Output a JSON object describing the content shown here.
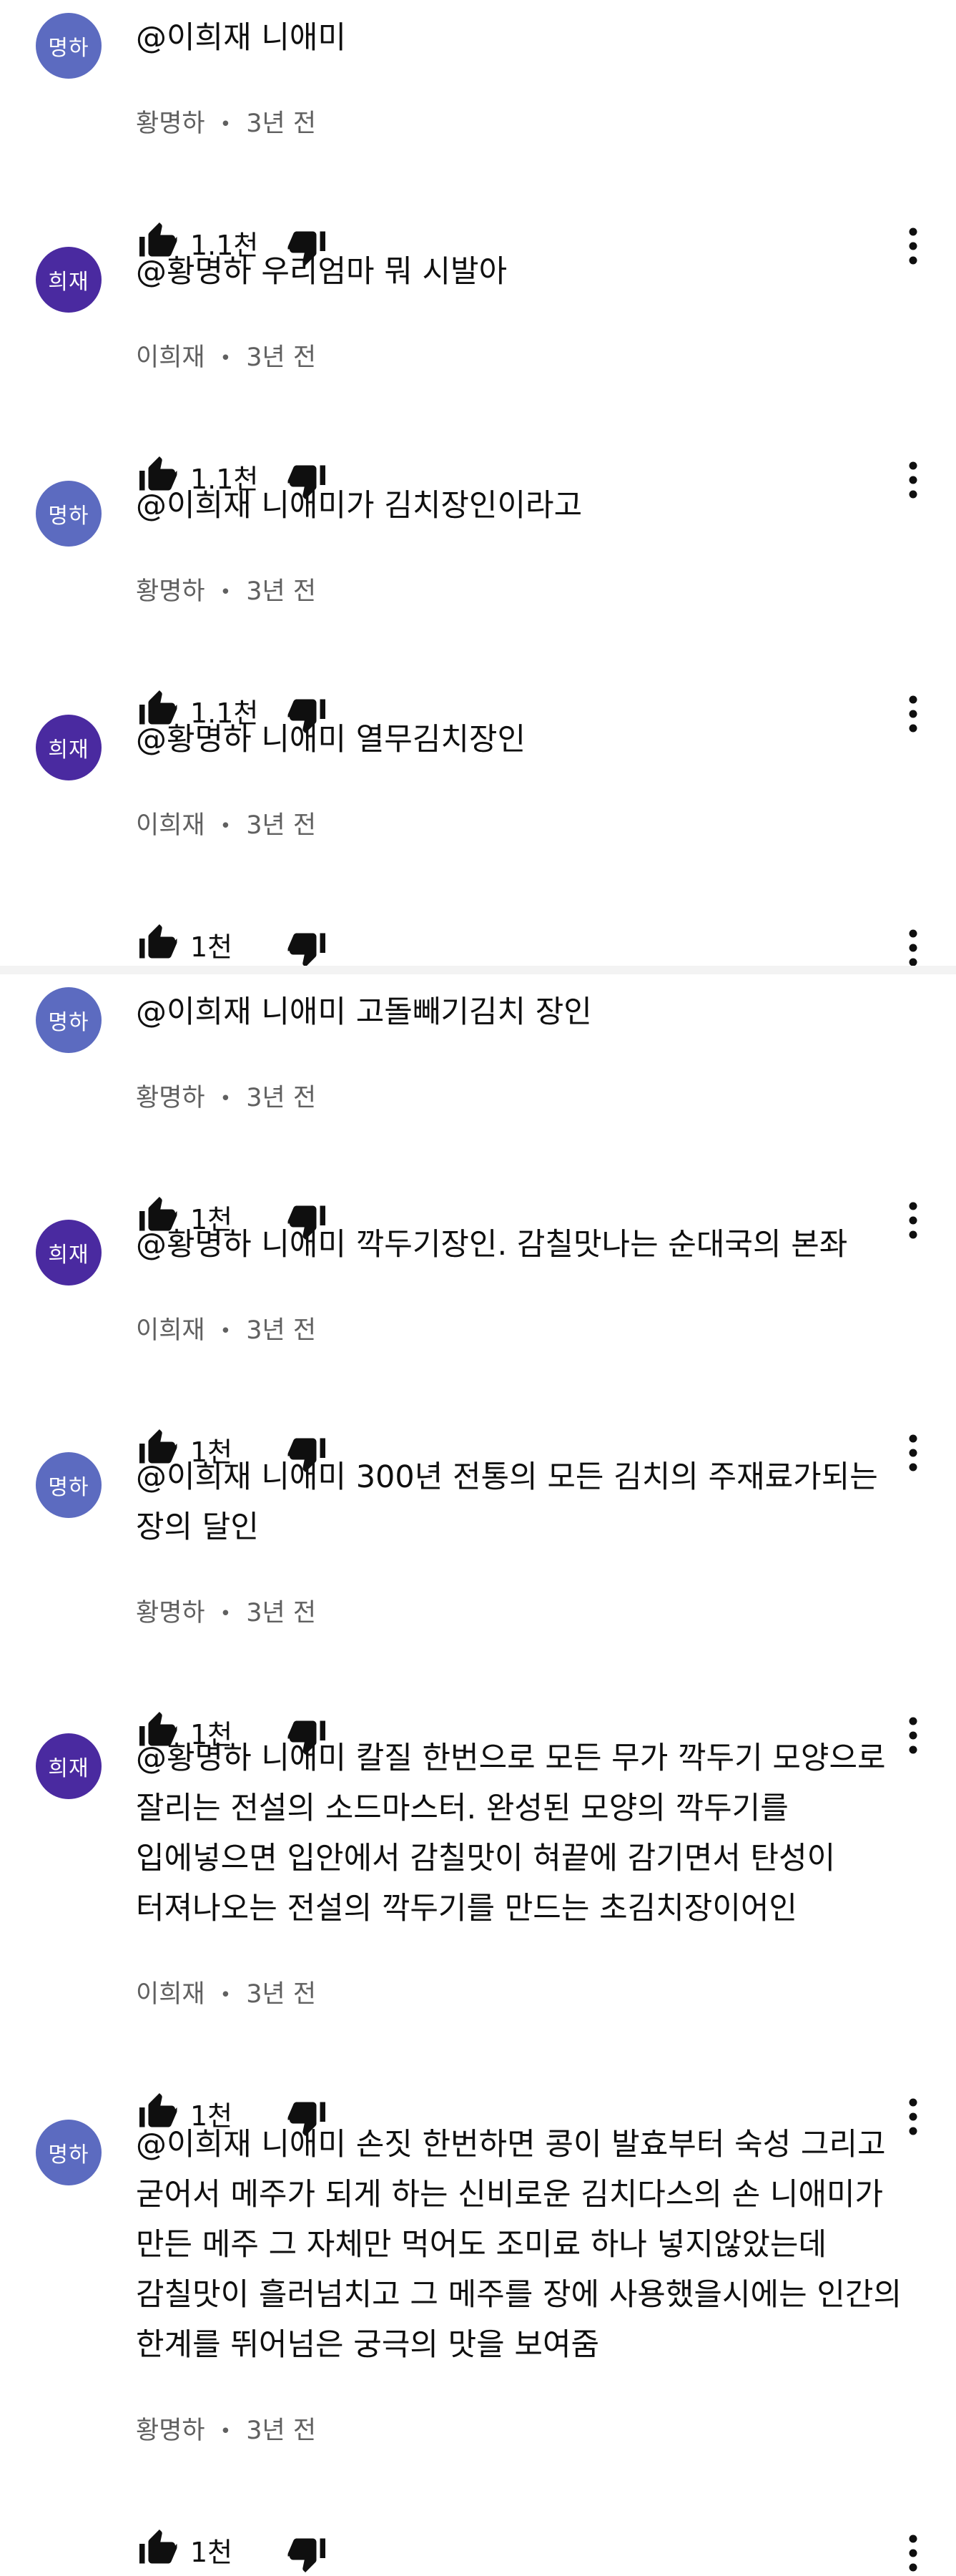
{
  "comments": [
    {
      "initials": "명하",
      "color": "#5c6bc0",
      "text": "@이희재 니애미",
      "author": "황명하",
      "time": "3년 전",
      "likes": "1.1천"
    },
    {
      "initials": "희재",
      "color": "#4a2aa0",
      "text": "@황명하 우리엄마 뭐 시발아",
      "author": "이희재",
      "time": "3년 전",
      "likes": "1.1천"
    },
    {
      "initials": "명하",
      "color": "#5c6bc0",
      "text": "@이희재 니애미가 김치장인이라고",
      "author": "황명하",
      "time": "3년 전",
      "likes": "1.1천"
    },
    {
      "initials": "희재",
      "color": "#4a2aa0",
      "text": "@황명하 니애미 열무김치장인",
      "author": "이희재",
      "time": "3년 전",
      "likes": "1천"
    },
    {
      "initials": "명하",
      "color": "#5c6bc0",
      "text": "@이희재 니애미 고돌빼기김치 장인",
      "author": "황명하",
      "time": "3년 전",
      "likes": "1천"
    },
    {
      "initials": "희재",
      "color": "#4a2aa0",
      "text": "@황명하 니애미 깍두기장인. 감칠맛나는 순대국의 본좌",
      "author": "이희재",
      "time": "3년 전",
      "likes": "1천"
    },
    {
      "initials": "명하",
      "color": "#5c6bc0",
      "text": "@이희재 니애미 300년 전통의 모든 김치의 주재료가되는 장의 달인",
      "author": "황명하",
      "time": "3년 전",
      "likes": "1천"
    },
    {
      "initials": "희재",
      "color": "#4a2aa0",
      "text": "@황명하 니애미 칼질 한번으로 모든 무가 깍두기 모양으로 잘리는 전설의 소드마스터. 완성된 모양의 깍두기를 입에넣으면 입안에서 감칠맛이 혀끝에 감기면서 탄성이 터져나오는 전설의 깍두기를 만드는  초김치장이어인",
      "author": "이희재",
      "time": "3년 전",
      "likes": "1천"
    },
    {
      "initials": "명하",
      "color": "#5c6bc0",
      "text": "@이희재 니애미 손짓 한번하면 콩이 발효부터 숙성 그리고 굳어서 메주가 되게 하는 신비로운 김치다스의 손 니애미가 만든 메주 그 자체만 먹어도 조미료 하나 넣지않았는데 감칠맛이 흘러넘치고 그 메주를 장에 사용했을시에는 인간의 한계를 뛰어넘은 궁극의 맛을 보여줌",
      "author": "황명하",
      "time": "3년 전",
      "likes": "1천"
    }
  ],
  "meta_separator": "•",
  "icons": {
    "like": "thumbs-up-icon",
    "dislike": "thumbs-down-icon",
    "more": "more-vert-icon"
  }
}
